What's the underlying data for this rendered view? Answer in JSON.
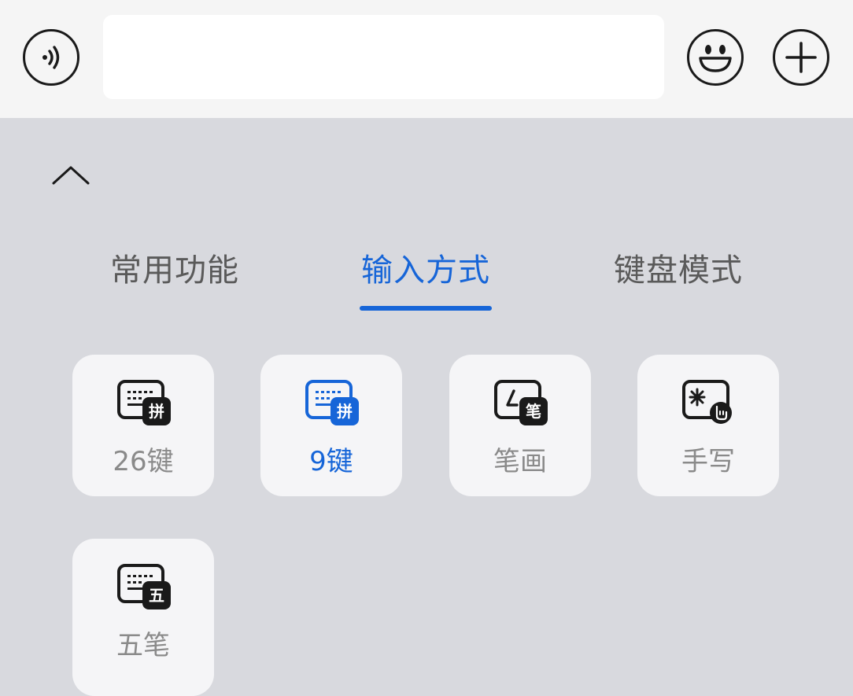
{
  "colors": {
    "accent": "#1665d8",
    "panel_bg": "#d8d9de",
    "topbar_bg": "#f5f5f5",
    "card_bg": "#f5f5f7",
    "inactive_text": "#8a8a8a",
    "tab_text": "#5a5a5a"
  },
  "topbar": {
    "voice_icon": "voice-icon",
    "input_value": "",
    "emoji_icon": "smiley-icon",
    "add_icon": "plus-icon"
  },
  "panel": {
    "collapse_icon": "chevron-up-icon",
    "tabs": [
      {
        "label": "常用功能",
        "active": false
      },
      {
        "label": "输入方式",
        "active": true
      },
      {
        "label": "键盘模式",
        "active": false
      }
    ],
    "modes": [
      {
        "label": "26键",
        "badge": "拼",
        "icon": "keyboard-pinyin-icon",
        "active": false
      },
      {
        "label": "9键",
        "badge": "拼",
        "icon": "keyboard-pinyin-icon",
        "active": true
      },
      {
        "label": "笔画",
        "badge": "笔",
        "icon": "stroke-icon",
        "active": false
      },
      {
        "label": "手写",
        "badge": "",
        "icon": "handwriting-icon",
        "active": false
      },
      {
        "label": "五笔",
        "badge": "五",
        "icon": "keyboard-wubi-icon",
        "active": false
      }
    ]
  }
}
